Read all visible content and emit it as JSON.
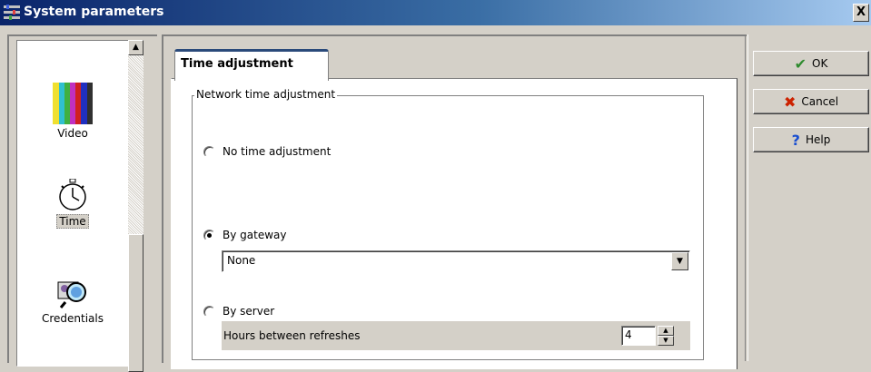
{
  "window": {
    "title": "System parameters",
    "close_label": "X"
  },
  "sidebar": {
    "items": [
      {
        "label": "Video",
        "icon": "video-color-bars-icon",
        "selected": false
      },
      {
        "label": "Time",
        "icon": "stopwatch-icon",
        "selected": true
      },
      {
        "label": "Credentials",
        "icon": "credentials-magnifier-icon",
        "selected": false
      }
    ]
  },
  "tabs": [
    {
      "label": "Time adjustment",
      "active": true
    }
  ],
  "group": {
    "title": "Network time adjustment",
    "options": {
      "no_adjust": {
        "label": "No time adjustment",
        "checked": false
      },
      "gateway": {
        "label": "By gateway",
        "checked": true
      },
      "server": {
        "label": "By server",
        "checked": false
      }
    },
    "gateway_select": {
      "value": "None"
    },
    "hours": {
      "label": "Hours between refreshes",
      "value": "4"
    }
  },
  "buttons": {
    "ok": {
      "label": "OK",
      "icon": "checkmark-icon",
      "color": "#2e8b2e"
    },
    "cancel": {
      "label": "Cancel",
      "icon": "red-x-icon",
      "color": "#cc2200"
    },
    "help": {
      "label": "Help",
      "icon": "question-mark-icon",
      "color": "#1a4fd0"
    }
  }
}
